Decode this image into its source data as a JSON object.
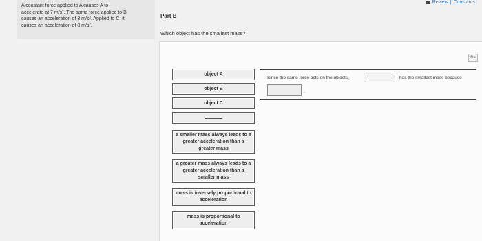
{
  "problem": {
    "lines": [
      "A constant force applied to A causes A to",
      "accelerate at 7 m/s². The same force applied to B",
      "causes an acceleration of 3 m/s². Applied to C, it",
      "causes an acceleration of 8 m/s²."
    ]
  },
  "header": {
    "review_label": "Review",
    "separator": "|",
    "constants_label": "Constants"
  },
  "part": {
    "title": "Part B",
    "question": "Which object has the smallest mass?"
  },
  "reset_label": "Re",
  "tiles": {
    "objects": [
      "object A",
      "object B",
      "object C"
    ],
    "blank": "",
    "statements": [
      "a smaller mass always leads to a greater acceleration than a greater mass",
      "a greater mass always leads to a greater acceleration than a smaller mass",
      "mass is inversely proportional to acceleration",
      "mass is proportional to acceleration"
    ]
  },
  "sentence": {
    "part1": "Since the same force acts on the objects,",
    "part2": "has the smallest mass because",
    "end": "."
  }
}
